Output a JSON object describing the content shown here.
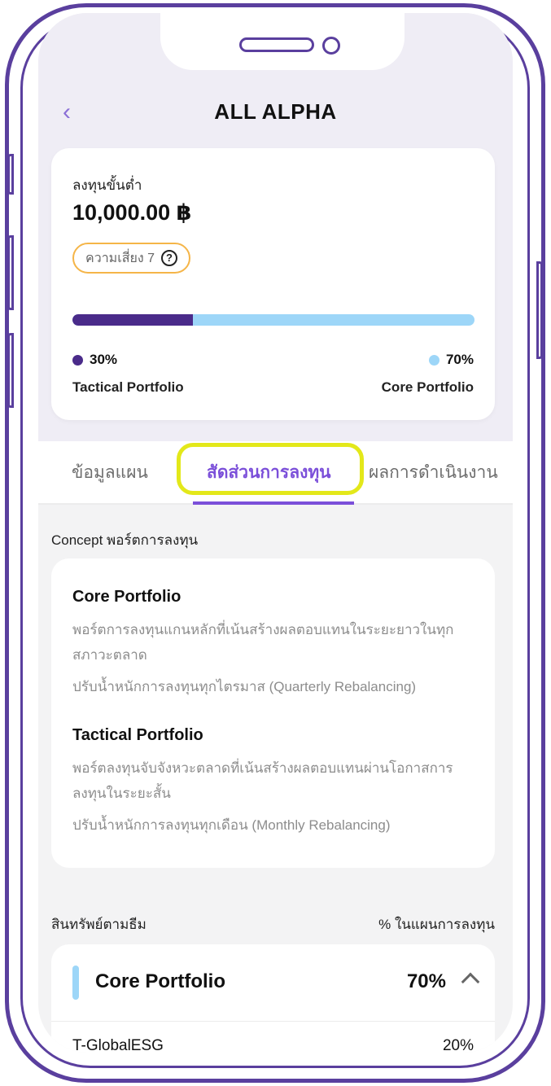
{
  "header": {
    "back_icon": "chevron-left-icon",
    "title": "ALL ALPHA"
  },
  "summary": {
    "min_invest_label": "ลงทุนขั้นต่ำ",
    "min_invest_value": "10,000.00 ฿",
    "risk_label": "ความเสี่ยง 7",
    "help_icon": "question-circle-icon",
    "allocation": {
      "tactical_fraction": 0.3,
      "tactical_pct": "30%",
      "tactical_name": "Tactical Portfolio",
      "core_pct": "70%",
      "core_name": "Core Portfolio"
    },
    "colors": {
      "tactical": "#4a2b8a",
      "core": "#9dd6f8",
      "accent": "#7b4fd9",
      "risk_border": "#f5b548",
      "highlight": "#e3e81a"
    }
  },
  "tabs": [
    {
      "label": "ข้อมูลแผน",
      "active": false
    },
    {
      "label": "สัดส่วนการลงทุน",
      "active": true
    },
    {
      "label": "ผลการดำเนินงาน",
      "active": false
    }
  ],
  "concept": {
    "section_label": "Concept พอร์ตการลงทุน",
    "core": {
      "title": "Core Portfolio",
      "desc": "พอร์ตการลงทุนแกนหลักที่เน้นสร้างผลตอบแทนในระยะยาวในทุกสภาวะตลาด",
      "rebalance": "ปรับน้ำหนักการลงทุนทุกไตรมาส (Quarterly Rebalancing)"
    },
    "tactical": {
      "title": "Tactical Portfolio",
      "desc": "พอร์ตลงทุนจับจังหวะตลาดที่เน้นสร้างผลตอบแทนผ่านโอกาสการลงทุนในระยะสั้น",
      "rebalance": "ปรับน้ำหนักการลงทุนทุกเดือน (Monthly Rebalancing)"
    }
  },
  "assets": {
    "label": "สินทรัพย์ตามธีม",
    "pct_label": "% ในแผนการลงทุน",
    "group": {
      "name": "Core Portfolio",
      "pct": "70%",
      "toggle_icon": "chevron-up-icon"
    },
    "funds": [
      {
        "name": "T-GlobalESG",
        "pct": "20%"
      }
    ]
  }
}
